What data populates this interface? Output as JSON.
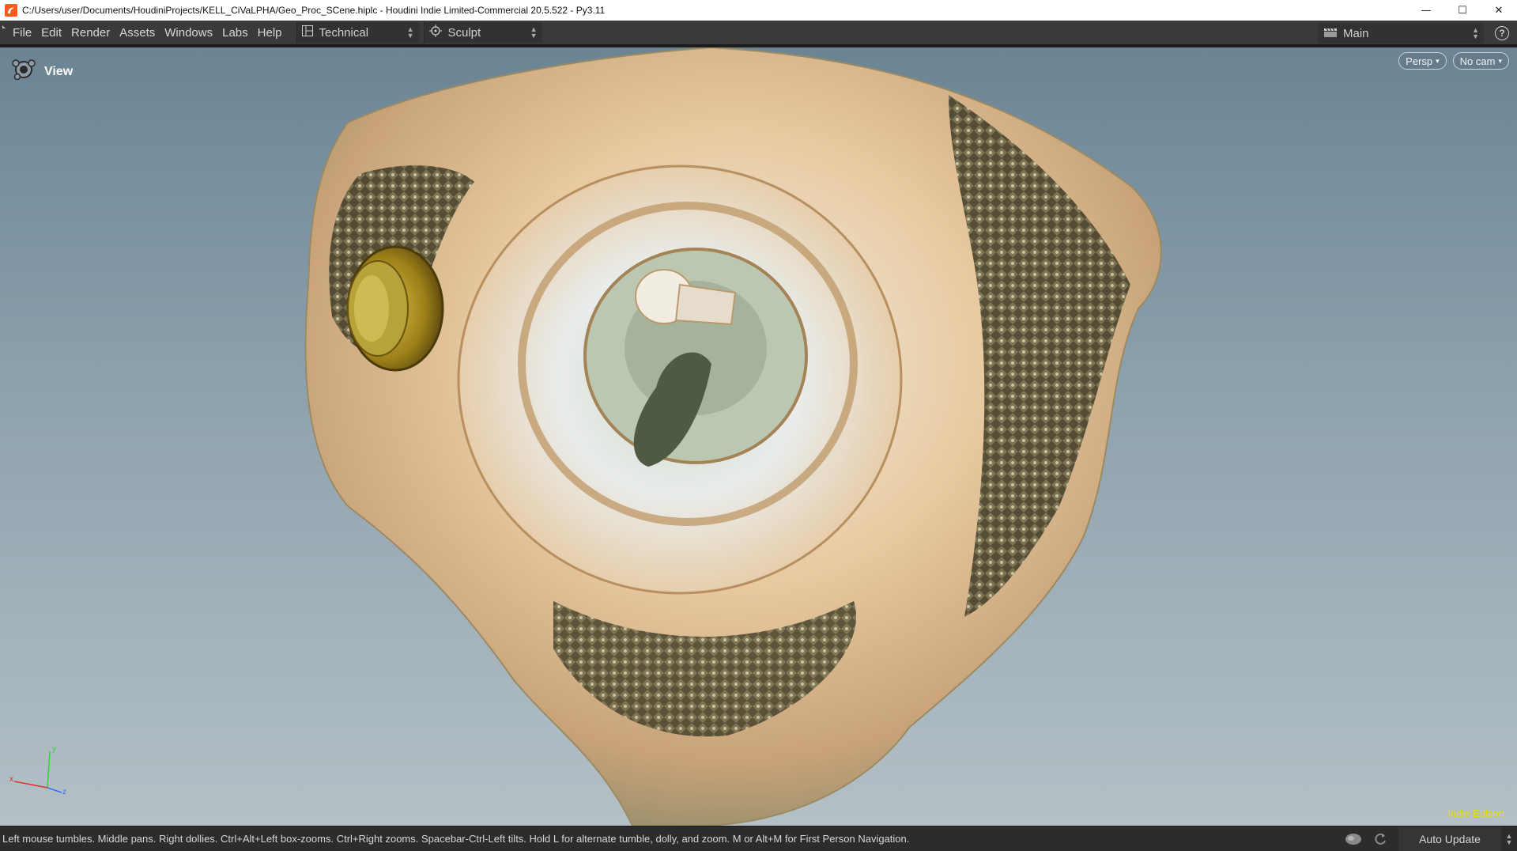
{
  "titlebar": {
    "title": "C:/Users/user/Documents/HoudiniProjects/KELL_CiVaLPHA/Geo_Proc_SCene.hiplc - Houdini Indie Limited-Commercial 20.5.522 - Py3.11",
    "minimize": "—",
    "maximize": "☐",
    "close": "✕"
  },
  "menubar": {
    "items": [
      "File",
      "Edit",
      "Render",
      "Assets",
      "Windows",
      "Labs",
      "Help"
    ],
    "desktop": "Technical",
    "shelf": "Sculpt",
    "main": "Main",
    "help": "?"
  },
  "viewport": {
    "label": "View",
    "persp": "Persp",
    "camera": "No cam",
    "watermark": "Indie Edition",
    "axes": {
      "x": "x",
      "y": "y",
      "z": "z"
    },
    "colors": {
      "x_axis": "#e03030",
      "y_axis": "#35d035",
      "z_axis": "#3a6ff0",
      "watermark": "#e8e000"
    }
  },
  "statusbar": {
    "message": "Left mouse tumbles. Middle pans. Right dollies. Ctrl+Alt+Left box-zooms. Ctrl+Right zooms. Spacebar-Ctrl-Left tilts. Hold L for alternate tumble, dolly, and zoom. M or Alt+M for First Person Navigation.",
    "auto_update": "Auto Update"
  }
}
